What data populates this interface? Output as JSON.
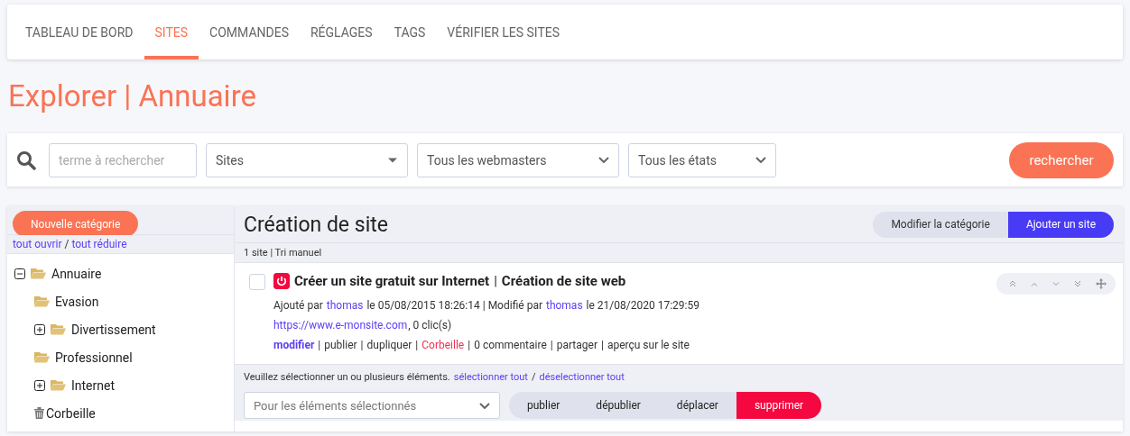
{
  "tabs": [
    {
      "label": "TABLEAU DE BORD",
      "selected": false
    },
    {
      "label": "SITES",
      "selected": true
    },
    {
      "label": "COMMANDES",
      "selected": false
    },
    {
      "label": "RÉGLAGES",
      "selected": false
    },
    {
      "label": "TAGS",
      "selected": false
    },
    {
      "label": "VÉRIFIER LES SITES",
      "selected": false
    }
  ],
  "page_title": "Explorer | Annuaire",
  "search": {
    "placeholder": "terme à rechercher",
    "selects": [
      {
        "value": "Sites",
        "kind": "triangle"
      },
      {
        "value": "Tous les webmasters",
        "kind": "chevron"
      },
      {
        "value": "Tous les états",
        "kind": "chevron"
      }
    ],
    "button": "rechercher"
  },
  "sidebar": {
    "new_button": "Nouvelle catégorie",
    "expand_all": "tout ouvrir",
    "separator": "/",
    "collapse_all": "tout réduire",
    "tree": [
      {
        "label": "Annuaire",
        "kind": "folder",
        "expanded": true,
        "children": [
          {
            "label": "Evasion",
            "kind": "folder"
          },
          {
            "label": "Divertissement",
            "kind": "folder",
            "expanded": false
          },
          {
            "label": "Professionnel",
            "kind": "folder"
          },
          {
            "label": "Internet",
            "kind": "folder",
            "expanded": false
          },
          {
            "label": "Corbeille",
            "kind": "trash"
          }
        ]
      }
    ]
  },
  "category": {
    "title": "Création de site",
    "buttons": [
      {
        "label": "Modifier la catégorie",
        "kind": "secondary"
      },
      {
        "label": "Ajouter un site",
        "kind": "primary"
      }
    ],
    "info": "1 site | Tri manuel",
    "sites": [
      {
        "checked": false,
        "published": false,
        "title": "Créer un site gratuit sur Internet",
        "separator": "|",
        "subtitle": "Création de site web",
        "lines": [
          [
            {
              "text": "Ajouté par",
              "kind": "text"
            },
            {
              "text": "thomas",
              "kind": "link"
            },
            {
              "text": "le 05/08/2015 18:26:14 | Modifié par",
              "kind": "text"
            },
            {
              "text": "thomas",
              "kind": "link"
            },
            {
              "text": "le 21/08/2020 17:29:59",
              "kind": "text"
            }
          ],
          [
            {
              "text": "https://www.e-monsite.com",
              "kind": "link"
            },
            {
              "text": ", 0 clic(s)",
              "kind": "suffix"
            }
          ],
          [
            {
              "text": "modifier",
              "kind": "strong"
            },
            {
              "text": "|",
              "kind": "text"
            },
            {
              "text": "publier",
              "kind": "action"
            },
            {
              "text": "|",
              "kind": "text"
            },
            {
              "text": "dupliquer",
              "kind": "action"
            },
            {
              "text": "|",
              "kind": "text"
            },
            {
              "text": "Corbeille",
              "kind": "danger"
            },
            {
              "text": "|",
              "kind": "text"
            },
            {
              "text": "0 commentaire",
              "kind": "action"
            },
            {
              "text": "|",
              "kind": "text"
            },
            {
              "text": "partager",
              "kind": "action"
            },
            {
              "text": "|",
              "kind": "text"
            },
            {
              "text": "aperçu sur le site",
              "kind": "action"
            }
          ]
        ]
      }
    ],
    "selection": {
      "message": "Veuillez sélectionner un ou plusieurs éléments.",
      "select_all": "sélectionner tout",
      "separator": "/",
      "deselect_all": "déselectionner tout",
      "bulk_placeholder": "Pour les éléments sélectionnés",
      "actions": [
        {
          "label": "publier",
          "kind": "plain"
        },
        {
          "label": "dépublier",
          "kind": "plain"
        },
        {
          "label": "déplacer",
          "kind": "plain"
        },
        {
          "label": "supprimer",
          "kind": "danger"
        }
      ]
    }
  }
}
